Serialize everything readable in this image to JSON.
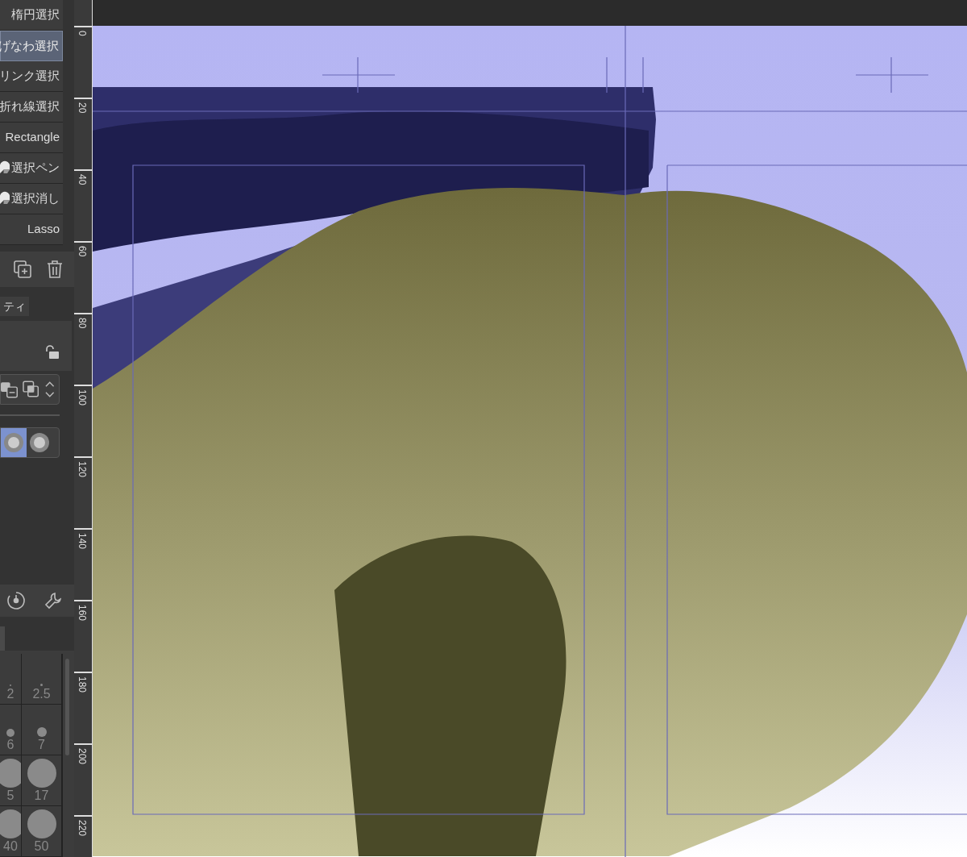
{
  "tool_list": [
    {
      "label": "楕円選択",
      "selected": false,
      "kind": "text"
    },
    {
      "label": "げなわ選択",
      "selected": true,
      "kind": "text"
    },
    {
      "label": "リンク選択",
      "selected": false,
      "kind": "text"
    },
    {
      "label": "折れ線選択",
      "selected": false,
      "kind": "text"
    },
    {
      "label": "Rectangle",
      "selected": false,
      "kind": "text"
    },
    {
      "label": "選択ペン",
      "selected": false,
      "kind": "icon"
    },
    {
      "label": "選択消し",
      "selected": false,
      "kind": "icon"
    },
    {
      "label": "Lasso",
      "selected": false,
      "kind": "text"
    }
  ],
  "property_tab": {
    "label": "ティ"
  },
  "brush_tips": [
    {
      "selected": true
    },
    {
      "selected": false
    }
  ],
  "brush_sizes": [
    {
      "label": "2"
    },
    {
      "label": "2.5"
    },
    {
      "label": "6"
    },
    {
      "label": "7"
    },
    {
      "label": "5"
    },
    {
      "label": "17"
    },
    {
      "label": "40"
    },
    {
      "label": "50"
    }
  ],
  "ruler": [
    "0",
    "20",
    "40",
    "60",
    "80",
    "100",
    "120",
    "140",
    "160",
    "180",
    "200",
    "220"
  ]
}
